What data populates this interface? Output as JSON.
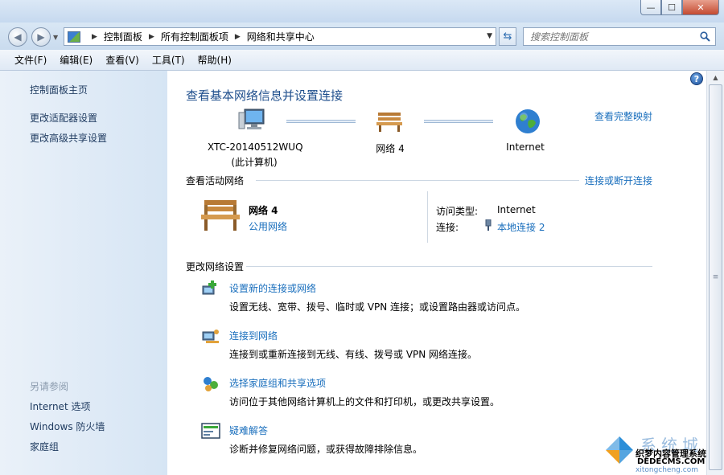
{
  "window": {
    "minimize_glyph": "—",
    "maximize_glyph": "☐",
    "close_glyph": "✕"
  },
  "address": {
    "crumbs": [
      "控制面板",
      "所有控制面板项",
      "网络和共享中心"
    ],
    "search_placeholder": "搜索控制面板"
  },
  "menu": [
    "文件(F)",
    "编辑(E)",
    "查看(V)",
    "工具(T)",
    "帮助(H)"
  ],
  "sidebar": {
    "home": "控制面板主页",
    "links": [
      "更改适配器设置",
      "更改高级共享设置"
    ],
    "see_also_heading": "另请参阅",
    "see_also": [
      "Internet 选项",
      "Windows 防火墙",
      "家庭组"
    ]
  },
  "main": {
    "title": "查看基本网络信息并设置连接",
    "full_map_link": "查看完整映射",
    "map": {
      "computer_name": "XTC-20140512WUQ",
      "computer_sub": "(此计算机)",
      "network_name": "网络  4",
      "internet": "Internet"
    },
    "active_section": {
      "label": "查看活动网络",
      "disconnect_link": "连接或断开连接",
      "network_name": "网络  4",
      "network_type": "公用网络",
      "access_type_label": "访问类型:",
      "access_type_value": "Internet",
      "connections_label": "连接:",
      "connections_value": "本地连接 2"
    },
    "change_section": {
      "label": "更改网络设置",
      "tasks": [
        {
          "title": "设置新的连接或网络",
          "desc": "设置无线、宽带、拨号、临时或 VPN 连接；或设置路由器或访问点。"
        },
        {
          "title": "连接到网络",
          "desc": "连接到或重新连接到无线、有线、拨号或 VPN 网络连接。"
        },
        {
          "title": "选择家庭组和共享选项",
          "desc": "访问位于其他网络计算机上的文件和打印机，或更改共享设置。"
        },
        {
          "title": "疑难解答",
          "desc": "诊断并修复网络问题，或获得故障排除信息。"
        }
      ]
    },
    "help_glyph": "?"
  },
  "watermark": {
    "brand": "系统城",
    "line1": "织梦内容管理系统",
    "line2": "DEDECMS.COM",
    "line3": "xitongcheng.com"
  }
}
